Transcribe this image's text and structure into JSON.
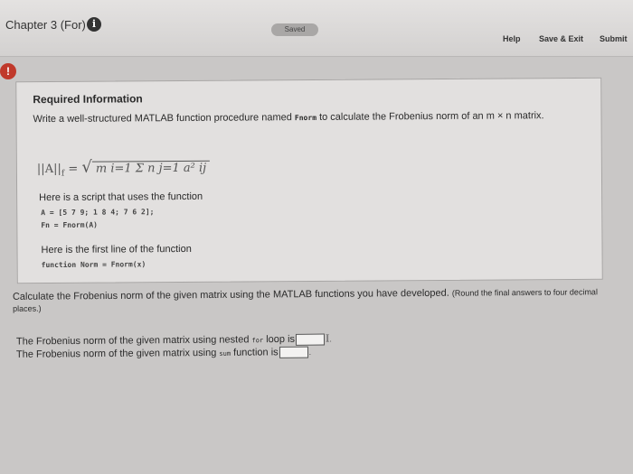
{
  "header": {
    "chapter": "Chapter 3 (For)",
    "info_icon": "i",
    "saved": "Saved",
    "help": "Help",
    "save_exit": "Save & Exit",
    "submit": "Submit"
  },
  "alert_icon": "!",
  "info_box": {
    "title": "Required Information",
    "prompt_pre": "Write a well-structured MATLAB function procedure named",
    "prompt_func": "Fnorm",
    "prompt_post": "to calculate the Frobenius norm of an m × n matrix.",
    "formula_lhs": "||A||",
    "formula_sub": "f",
    "formula_eq": "=",
    "formula_sqrt": "√",
    "formula_rhs": "Σ",
    "formula_rhs_detail": "m i=1 Σ n j=1 a² ij",
    "script_label": "Here is a script that uses the function",
    "code_line_1": "A = [5 7 9; 1 8 4; 7 6 2];",
    "code_line_2": "Fn = Fnorm(A)",
    "first_line_label": "Here is the first line of the function",
    "code_line_3": "function Norm = Fnorm(x)"
  },
  "question": {
    "text": "Calculate the Frobenius norm of the given matrix using the MATLAB functions you have developed.",
    "note": "(Round the final answers to four decimal places.)",
    "answer1_pre": "The Frobenius norm of the given matrix using nested",
    "answer1_code": "for",
    "answer1_post": "loop is",
    "answer1_value": "",
    "answer2_pre": "The Frobenius norm of the given matrix using",
    "answer2_code": "sum",
    "answer2_post": "function is",
    "answer2_value": ""
  }
}
